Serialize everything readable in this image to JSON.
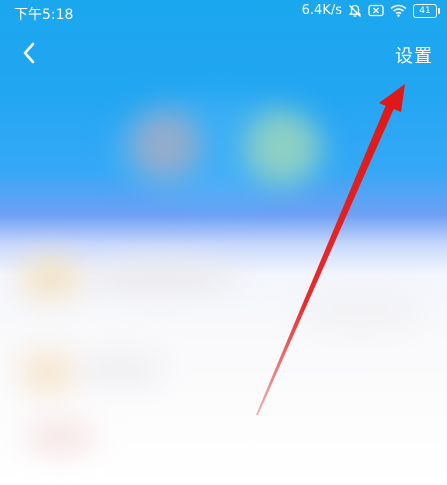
{
  "status_bar": {
    "time": "下午5:18",
    "network_speed": "6.4K/s",
    "battery_level": "41",
    "icons": [
      "mute-bell-icon",
      "sim-off-icon",
      "wifi-icon",
      "battery-icon"
    ]
  },
  "header": {
    "back_icon": "chevron-left-icon",
    "settings_label": "设置"
  },
  "annotation": {
    "icon": "red-arrow-icon",
    "color": "#e52222"
  },
  "colors": {
    "header_blue": "#1aa7ee",
    "text_white": "#ffffff"
  }
}
